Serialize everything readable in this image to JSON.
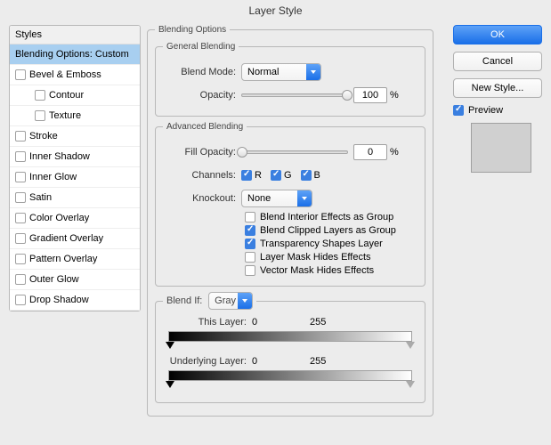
{
  "windowTitle": "Layer Style",
  "stylesHeader": "Styles",
  "stylesItems": [
    {
      "label": "Blending Options: Custom",
      "selected": true,
      "checkbox": false
    },
    {
      "label": "Bevel & Emboss",
      "checked": false
    },
    {
      "label": "Contour",
      "checked": false,
      "indent": true
    },
    {
      "label": "Texture",
      "checked": false,
      "indent": true
    },
    {
      "label": "Stroke",
      "checked": false
    },
    {
      "label": "Inner Shadow",
      "checked": false
    },
    {
      "label": "Inner Glow",
      "checked": false
    },
    {
      "label": "Satin",
      "checked": false
    },
    {
      "label": "Color Overlay",
      "checked": false
    },
    {
      "label": "Gradient Overlay",
      "checked": false
    },
    {
      "label": "Pattern Overlay",
      "checked": false
    },
    {
      "label": "Outer Glow",
      "checked": false
    },
    {
      "label": "Drop Shadow",
      "checked": false
    }
  ],
  "blendingOptions": {
    "legend": "Blending Options",
    "general": {
      "legend": "General Blending",
      "blendModeLabel": "Blend Mode:",
      "blendModeValue": "Normal",
      "opacityLabel": "Opacity:",
      "opacityValue": "100",
      "opacityUnit": "%"
    },
    "advanced": {
      "legend": "Advanced Blending",
      "fillOpacityLabel": "Fill Opacity:",
      "fillOpacityValue": "0",
      "fillOpacityUnit": "%",
      "channelsLabel": "Channels:",
      "channels": [
        {
          "label": "R",
          "checked": true
        },
        {
          "label": "G",
          "checked": true
        },
        {
          "label": "B",
          "checked": true
        }
      ],
      "knockoutLabel": "Knockout:",
      "knockoutValue": "None",
      "options": [
        {
          "label": "Blend Interior Effects as Group",
          "checked": false
        },
        {
          "label": "Blend Clipped Layers as Group",
          "checked": true
        },
        {
          "label": "Transparency Shapes Layer",
          "checked": true
        },
        {
          "label": "Layer Mask Hides Effects",
          "checked": false
        },
        {
          "label": "Vector Mask Hides Effects",
          "checked": false
        }
      ]
    },
    "blendIf": {
      "label": "Blend If:",
      "value": "Gray",
      "thisLayerLabel": "This Layer:",
      "thisLayerLow": "0",
      "thisLayerHigh": "255",
      "underLabel": "Underlying Layer:",
      "underLow": "0",
      "underHigh": "255"
    }
  },
  "buttons": {
    "ok": "OK",
    "cancel": "Cancel",
    "newStyle": "New Style...",
    "previewLabel": "Preview",
    "previewChecked": true
  }
}
